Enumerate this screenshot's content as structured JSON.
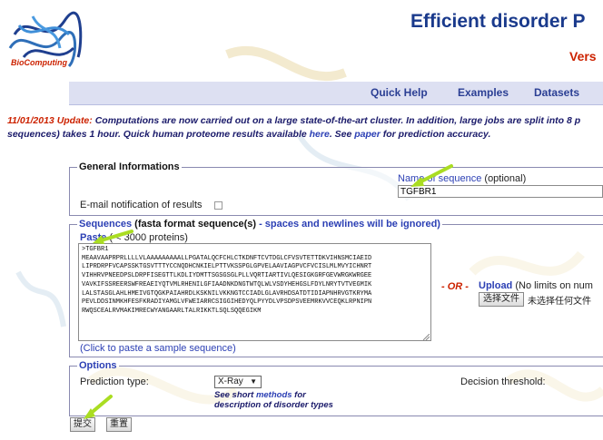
{
  "header": {
    "title": "Efficient disorder P",
    "subtitle": "Vers",
    "logo_text": "BioComputing"
  },
  "nav": {
    "items": [
      "Quick Help",
      "Examples",
      "Datasets"
    ]
  },
  "update": {
    "date": "11/01/2013 Update:",
    "text1": " Computations are now carried out on a large state-of-the-art cluster. In addition, large jobs are split into 8 p",
    "text2_a": "sequences) takes 1 hour. Quick human proteome results available ",
    "here_link": "here",
    "text2_b": ". See ",
    "paper_link": "paper",
    "text2_c": " for prediction accuracy."
  },
  "general": {
    "legend": "General Informations",
    "name_label_a": "Name ",
    "name_label_b": "of sequence",
    "name_label_c": " (optional)",
    "name_value": "TGFBR1",
    "email_label": "E-mail notification of results"
  },
  "sequences": {
    "legend_a": "Sequences",
    "legend_b": " (fasta format sequence(s) ",
    "legend_c": "- spaces and newlines will be ignored)",
    "paste_label_a": "Paste",
    "paste_label_b": " ( < 3000 proteins)",
    "value": ">TGFBR1\nMEAAVAAPRPRLLLLVLAAAAAAAAALLPGATALQCFCHLCTKDNFTCVTDGLCFVSVTETTDKVIHNSMCIAEID\nLIPRDRPFVCAPSSKTGSVTTTYCCNQDHCNKIELPTTVKSSPGLGPVELAAVIAGPVCFVCISLMLMVYICHNRT\nVIHHRVPNEEDPSLDRPFISEGTTLKDLIYDMTTSGSGSGLPLLVQRTIARTIVLQESIGKGRFGEVWRGKWRGEE\nVAVKIFSSREERSWFREAEIYQTVMLRHENILGFIAADNKDNGTWTQLWLVSDYHEHGSLFDYLNRYTVTVEGMIK\nLALSTASGLAHLHMEIVGTQGKPAIAHRDLKSKNILVKKNGTCCIADLGLAVRHDSATDTIDIAPNHRVGTKRYMA\nPEVLDDSINMKHFESFKRADIYAMGLVFWEIARRCSIGGIHEDYQLPYYDLVPSDPSVEEMRKVVCEQKLRPNIPN\nRWQSCEALRVMAKIMRECWYANGAARLTALRIKKTLSQLSQQEGIKM",
    "sample_link": "(Click to paste a sample sequence)",
    "or_label": "- OR -",
    "upload_label_a": "Upload",
    "upload_label_b": " (No limits on num",
    "choose_file": "选择文件",
    "no_file": "未选择任何文件"
  },
  "options": {
    "legend": "Options",
    "prediction_label": "Prediction type:",
    "prediction_value": "X-Ray",
    "short_a": "See short ",
    "short_link": "methods",
    "short_b": " for",
    "short_c": "description of disorder types",
    "threshold_label": "Decision threshold:"
  },
  "buttons": {
    "submit": "提交",
    "reset": "重置"
  },
  "colors": {
    "title": "#1a3a8c",
    "accent_red": "#cc2200",
    "link_blue": "#2b3fb4",
    "navbar": "#dde0f2",
    "arrow_green": "#aadd22"
  }
}
